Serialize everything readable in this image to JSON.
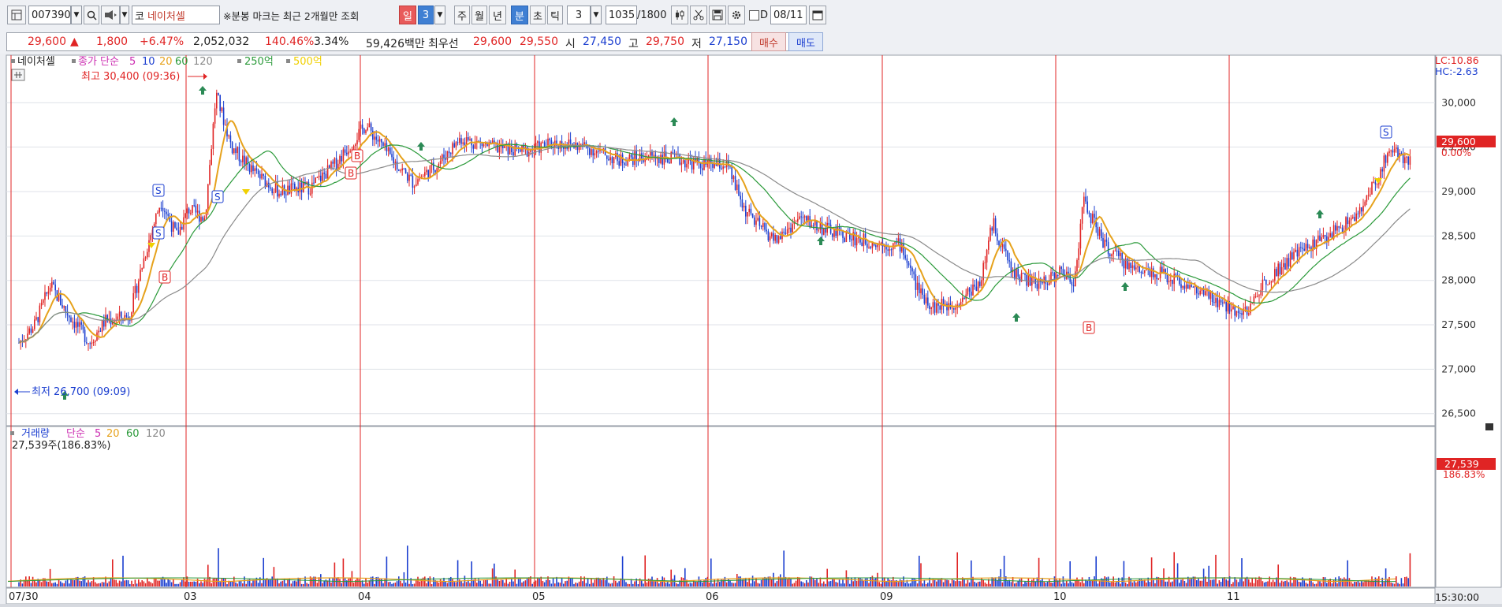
{
  "toolbar": {
    "code": "007390",
    "market_prefix": "코",
    "stock_name": "네이처셀",
    "notice": "※분봉 마크는 최근 2개월만 조회",
    "period_day": "일",
    "period_value": "3",
    "period_week": "주",
    "period_month": "월",
    "period_year": "년",
    "period_minute": "분",
    "period_second": "초",
    "period_tick": "틱",
    "interval_value": "3",
    "count": "1035",
    "count_total": "/1800",
    "d_label": "D",
    "date": "08/11"
  },
  "quote": {
    "price": "29,600",
    "change_arrow": "▲",
    "change": "1,800",
    "change_pct": "+6.47%",
    "volume": "2,052,032",
    "volume_ratio": "140.46%",
    "turnover": "3.34%",
    "trade_value": "59,426백만",
    "best_label": "최우선",
    "ask": "29,600",
    "bid": "29,550",
    "open_label": "시",
    "open": "27,450",
    "high_label": "고",
    "high": "29,750",
    "low_label": "저",
    "low": "27,150",
    "buy_label": "매수",
    "sell_label": "매도"
  },
  "price_panel": {
    "title": "네이처셀",
    "ma_label": "종가 단순",
    "ma_periods": [
      "5",
      "10",
      "20",
      "60",
      "120"
    ],
    "amount_labels": [
      "250억",
      "500억"
    ],
    "lc": "LC:10.86",
    "hc": "HC:-2.63",
    "max_label": "최고 30,400 (09:36)",
    "min_label": "최저 26,700 (09:09)",
    "current_price": "29,600",
    "current_pct": "0.00%",
    "y_ticks": [
      "30,000",
      "29,500",
      "29,000",
      "28,500",
      "28,000",
      "27,500",
      "27,000",
      "26,500"
    ]
  },
  "volume_panel": {
    "title": "거래량",
    "ma_label": "단순",
    "ma_periods": [
      "5",
      "20",
      "60",
      "120"
    ],
    "value_line": "27,539주(186.83%)",
    "current_volume": "27,539",
    "current_pct": "186.83%"
  },
  "x_axis": {
    "labels": [
      "07/30",
      "03",
      "04",
      "05",
      "06",
      "09",
      "10",
      "11"
    ],
    "time": "15:30:00"
  },
  "colors": {
    "up": "#e02424",
    "down": "#1c3fd0",
    "ma5": "#e6a21c",
    "ma20": "#2b9a3a",
    "ma60": "#8a8a8a",
    "ma120": "#8a8a8a",
    "background": "#ffffff"
  },
  "chart_data": {
    "type": "line",
    "categories": [
      "07/30",
      "03",
      "04",
      "05",
      "06",
      "09",
      "10",
      "11"
    ],
    "series": [
      {
        "name": "종가",
        "values": [
          27300,
          29100,
          29600,
          29400,
          28600,
          28100,
          28000,
          29600
        ]
      }
    ],
    "ylim": [
      26400,
      30500
    ]
  }
}
